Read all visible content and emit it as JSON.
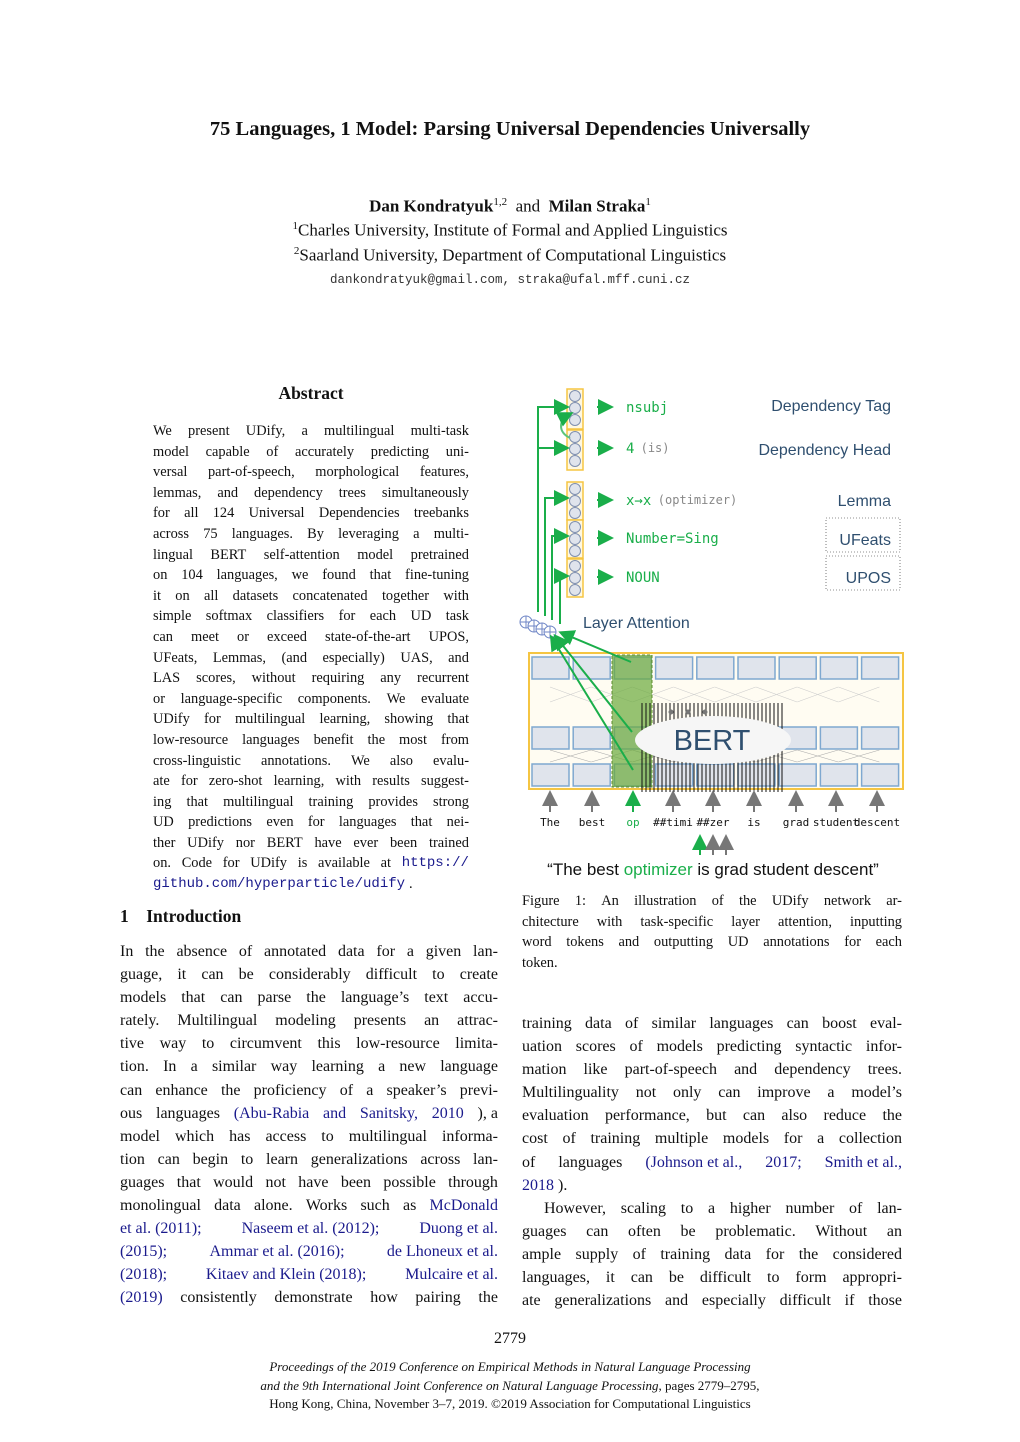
{
  "title": "75 Languages, 1 Model: Parsing Universal Dependencies Universally",
  "authors": {
    "author1": "Dan Kondratyuk",
    "author1_sup": "1,2",
    "and": "and",
    "author2": "Milan Straka",
    "author2_sup": "1",
    "aff1_sup": "1",
    "aff1": "Charles University, Institute of Formal and Applied Linguistics",
    "aff2_sup": "2",
    "aff2": "Saarland University, Department of Computational Linguistics",
    "emails": "dankondratyuk@gmail.com, straka@ufal.mff.cuni.cz"
  },
  "abstract": {
    "heading": "Abstract",
    "lines": [
      "We present UDify, a multilingual multi-task",
      "model capable of accurately predicting uni-",
      "versal part-of-speech, morphological features,",
      "lemmas, and dependency trees simultaneously",
      "for all 124 Universal Dependencies treebanks",
      "across 75 languages. By leveraging a multi-",
      "lingual BERT self-attention model pretrained",
      "on 104 languages, we found that fine-tuning",
      "it on all datasets concatenated together with",
      "simple softmax classifiers for each UD task",
      "can meet or exceed state-of-the-art UPOS,",
      "UFeats, Lemmas, (and especially) UAS, and",
      "LAS scores, without requiring any recurrent",
      "or language-specific components. We evaluate",
      "UDify for multilingual learning, showing that",
      "low-resource languages benefit the most from",
      "cross-linguistic annotations. We also evalu-",
      "ate for zero-shot learning, with results suggest-",
      "ing that multilingual training provides strong",
      "UD predictions even for languages that nei-",
      "ther UDify nor BERT have ever been trained"
    ],
    "code_prefix": "on. Code for UDify is available at",
    "code_url_part1": "https://",
    "code_url_part2": "github.com/hyperparticle/udify",
    "code_suffix": "."
  },
  "introduction": {
    "heading_num": "1",
    "heading": "Introduction",
    "left_lines": [
      "In the absence of annotated data for a given lan-",
      "guage, it can be considerably difficult to create",
      "models that can parse the language’s text accu-",
      "rately. Multilingual modeling presents an attrac-",
      "tive way to circumvent this low-resource limita-",
      "tion. In a similar way learning a new language",
      "can enhance the proficiency of a speaker’s previ-"
    ],
    "cite1_pre": "ous languages (",
    "cite1": "Abu-Rabia and Sanitsky",
    "cite1_year": "2010",
    "cite1_post": "), a",
    "left_lines2": [
      "model which has access to multilingual informa-",
      "tion can begin to learn generalizations across lan-",
      "guages that would not have been possible through"
    ],
    "works_pre": "monolingual data alone. Works such as",
    "cites": {
      "mcdonald_a": "McDonald",
      "mcdonald_b": "et al.",
      "mcdonald_y": "2011",
      "naseem": "Naseem et al.",
      "naseem_y": "2012",
      "duong": "Duong et al.",
      "duong_y": "2015",
      "ammar": "Ammar et al.",
      "ammar_y": "2016",
      "lhoneux": "de Lhoneux et al.",
      "lhoneux_y": "2018",
      "kitaev": "Kitaev and Klein",
      "kitaev_y": "2018",
      "mulcaire": "Mulcaire et al.",
      "mulcaire_y": "2019"
    },
    "last_left": "consistently demonstrate how pairing the",
    "right_lines": [
      "training data of similar languages can boost eval-",
      "uation scores of models predicting syntactic infor-",
      "mation like part-of-speech and dependency trees.",
      "Multilinguality not only can improve a model’s",
      "evaluation performance, but can also reduce the",
      "cost of training multiple models for a collection"
    ],
    "right_cite_pre": "of languages (",
    "johnson": "Johnson et al.",
    "johnson_y": "2017",
    "smith": "Smith et al.,",
    "smith_y": "2018",
    "right_cite_post": ").",
    "right_lines2": [
      "However, scaling to a higher number of lan-",
      "guages can often be problematic. Without an",
      "ample supply of training data for the considered",
      "languages, it can be difficult to form appropri-",
      "ate generalizations and especially difficult if those"
    ]
  },
  "figure": {
    "outputs": [
      {
        "value": "nsubj",
        "note": "",
        "task": "Dependency Tag"
      },
      {
        "value": "4",
        "note": "(is)",
        "task": "Dependency Head"
      },
      {
        "value": "x→x",
        "note": "(optimizer)",
        "task": "Lemma"
      },
      {
        "value": "Number=Sing",
        "note": "",
        "task": "UFeats"
      },
      {
        "value": "NOUN",
        "note": "",
        "task": "UPOS"
      }
    ],
    "layer_attention_label": "Layer Attention",
    "bert_label": "BERT",
    "tokens": [
      "The",
      "best",
      "op",
      "##timi",
      "##zer",
      "is",
      "grad",
      "student",
      "descent"
    ],
    "sentence_pre": "“The best ",
    "sentence_highlight": "optimizer",
    "sentence_post": " is grad student descent”",
    "colors": {
      "green": "#1aae4a",
      "task_blue": "#2f4f6f",
      "yellow": "#f5c542",
      "cell_fill": "#e0e4ec",
      "cell_stroke": "#7fa8d0",
      "highlight": "#6aaa3a"
    },
    "caption_lines": [
      "Figure 1: An illustration of the UDify network ar-",
      "chitecture with task-specific layer attention, inputting",
      "word tokens and outputting UD annotations for each"
    ],
    "caption_last": "token."
  },
  "page_number": "2779",
  "footer": {
    "line1": "Proceedings of the 2019 Conference on Empirical Methods in Natural Language Processing",
    "line2_italic": "and the 9th International Joint Conference on Natural Language Processing",
    "line2_rest": ", pages 2779–2795,",
    "line3": "Hong Kong, China, November 3–7, 2019. ©2019 Association for Computational Linguistics"
  }
}
